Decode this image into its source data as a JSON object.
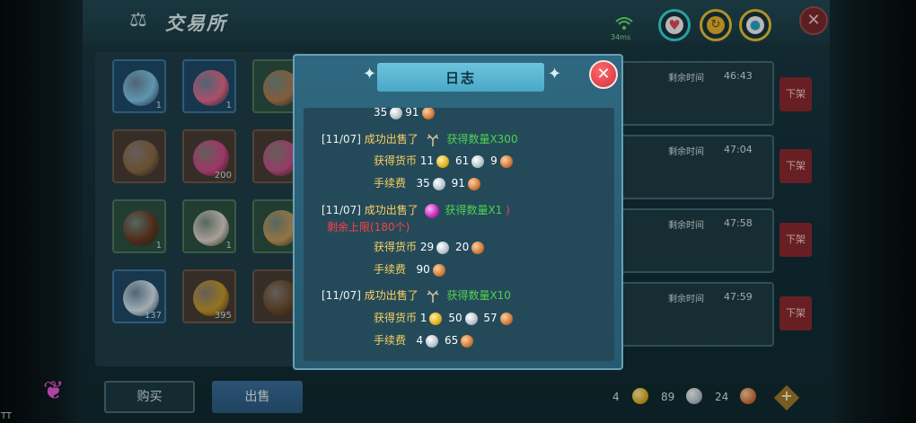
{
  "header": {
    "title": "交易所",
    "ping": "34ms"
  },
  "inventory": {
    "slots": [
      {
        "count": "1",
        "color": "blue",
        "art": "#7fc8e8"
      },
      {
        "count": "1",
        "color": "blue",
        "art": "#e56a8c"
      },
      {
        "count": "",
        "color": "green",
        "art": "#b07a50"
      },
      {
        "count": "",
        "color": "brown",
        "art": "#8a6a44"
      },
      {
        "count": "200",
        "color": "brown",
        "art": "#d24a8a"
      },
      {
        "count": "",
        "color": "brown",
        "art": "#c8508a"
      },
      {
        "count": "1",
        "color": "green",
        "art": "#6a3a22"
      },
      {
        "count": "1",
        "color": "green",
        "art": "#e0d6c8"
      },
      {
        "count": "",
        "color": "green",
        "art": "#c89a5a"
      },
      {
        "count": "137",
        "color": "blue",
        "art": "#d8e8f0"
      },
      {
        "count": "395",
        "color": "brown",
        "art": "#c89a2a"
      },
      {
        "count": "",
        "color": "brown",
        "art": "#6a4a2a"
      }
    ]
  },
  "listings": [
    {
      "label": "剩余时间",
      "time": "46:43",
      "delist": "下架"
    },
    {
      "label": "剩余时间",
      "time": "47:04",
      "delist": "下架"
    },
    {
      "label": "剩余时间",
      "time": "47:58",
      "delist": "下架"
    },
    {
      "label": "剩余时间",
      "time": "47:59",
      "delist": "下架"
    }
  ],
  "bottom": {
    "buy": "购买",
    "sell": "出售",
    "gold": "4",
    "silver": "89",
    "copper": "24"
  },
  "dialog": {
    "title": "日志",
    "entries": [
      {
        "date": "[11/07]",
        "action": "成功出售了",
        "item_note": "获得数量X300",
        "extra": "",
        "earn_label": "获得货币",
        "earn": {
          "gold": "11",
          "silver": "61",
          "copper": "9"
        },
        "fee_label": "手续费",
        "fee": {
          "silver": "35",
          "copper": "91"
        }
      },
      {
        "date": "[11/07]",
        "action": "成功出售了",
        "item_note": "获得数量X1",
        "extra": "剩余上限(180个)",
        "earn_label": "获得货币",
        "earn": {
          "gold": "",
          "silver": "29",
          "copper": "20"
        },
        "fee_label": "手续费",
        "fee": {
          "silver": "",
          "copper": "90"
        }
      },
      {
        "date": "[11/07]",
        "action": "成功出售了",
        "item_note": "获得数量X10",
        "extra": "",
        "earn_label": "获得货币",
        "earn": {
          "gold": "1",
          "silver": "50",
          "copper": "57"
        },
        "fee_label": "手续费",
        "fee": {
          "silver": "4",
          "copper": "65"
        }
      }
    ],
    "top_partial": {
      "silver": "35",
      "copper": "91"
    }
  },
  "corner": "TT"
}
